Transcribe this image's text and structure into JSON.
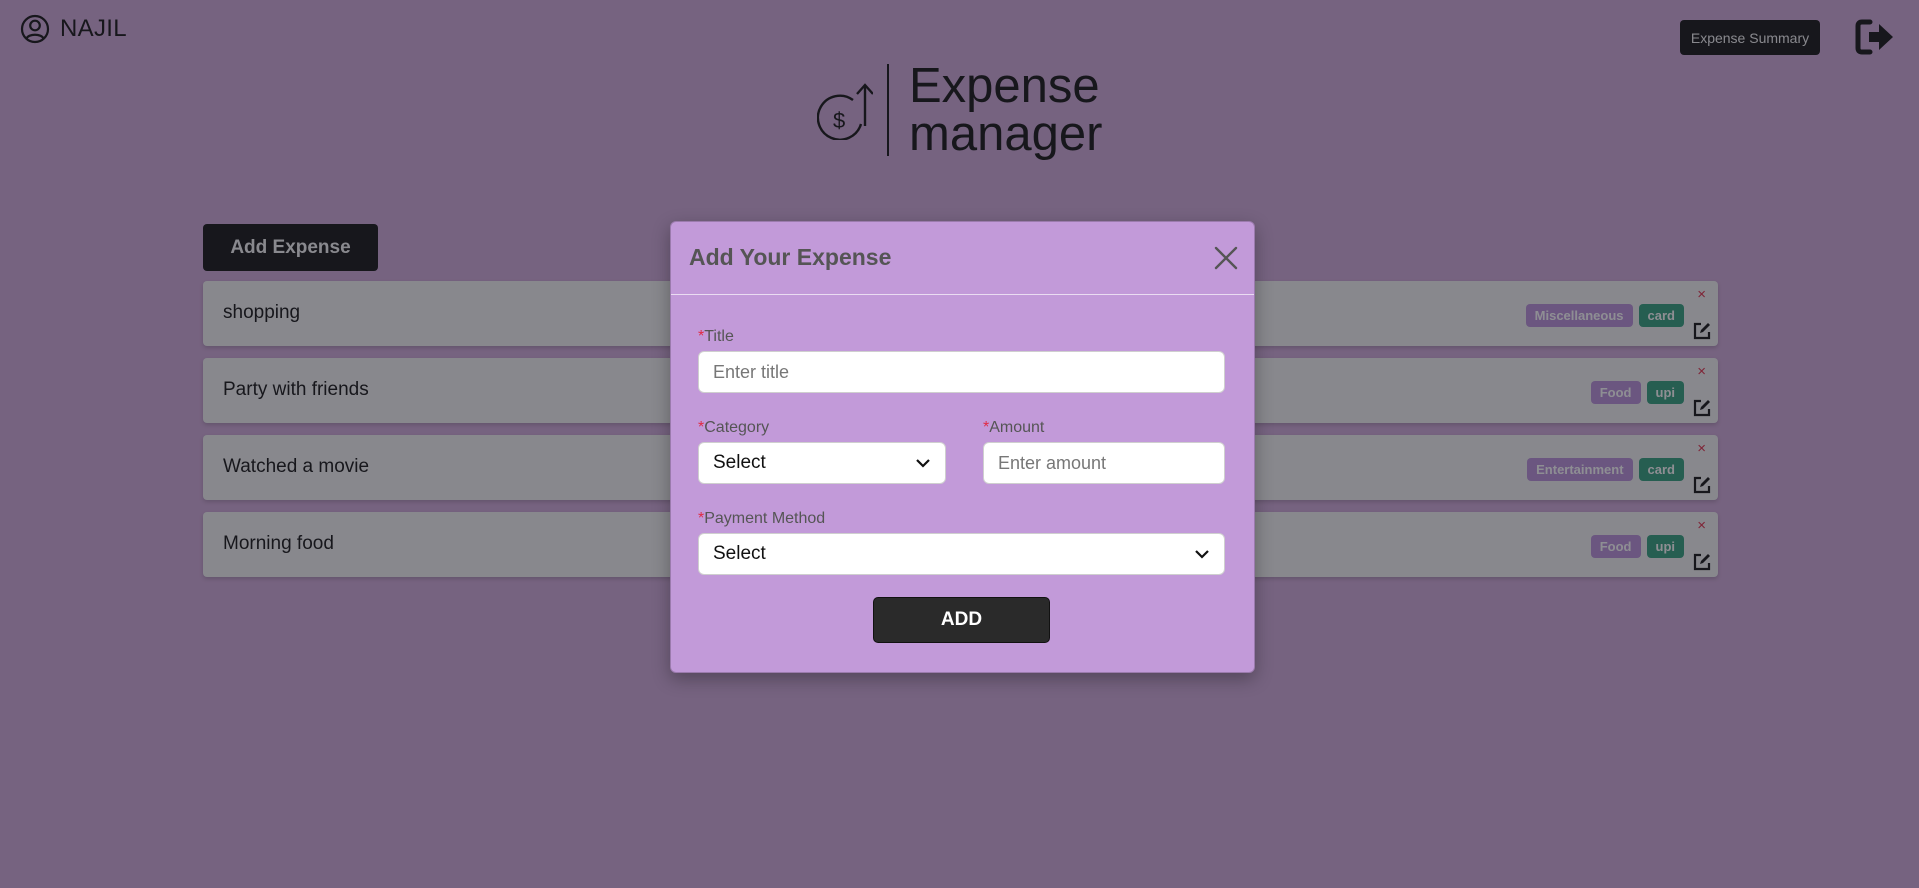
{
  "header": {
    "user_name": "NAJIL",
    "user_icon": "user-circle-icon",
    "summary_label": "Expense Summary",
    "logout_icon": "sign-out-icon"
  },
  "logo": {
    "line1": "Expense",
    "line2": "manager",
    "icon": "dollar-growth-icon"
  },
  "actions": {
    "add_expense_label": "Add Expense"
  },
  "expenses": [
    {
      "title": "shopping",
      "category": "Miscellaneous",
      "payment": "card"
    },
    {
      "title": "Party with friends",
      "category": "Food",
      "payment": "upi"
    },
    {
      "title": "Watched a movie",
      "category": "Entertainment",
      "payment": "card"
    },
    {
      "title": "Morning food",
      "category": "Food",
      "payment": "upi"
    }
  ],
  "row_controls": {
    "delete_glyph": "×",
    "edit_icon": "edit-icon"
  },
  "modal": {
    "title": "Add Your Expense",
    "close_icon": "close-icon",
    "required_mark": "*",
    "title_label": "Title",
    "title_placeholder": "Enter title",
    "category_label": "Category",
    "category_value": "Select",
    "amount_label": "Amount",
    "amount_placeholder": "Enter amount",
    "payment_label": "Payment Method",
    "payment_value": "Select",
    "add_label": "ADD"
  },
  "colors": {
    "page_bg": "#cfa8d8",
    "modal_bg": "#c29ad9",
    "category_tag": "#b88fd9",
    "payment_tag": "#2f9e7a",
    "required": "#e02b45"
  }
}
